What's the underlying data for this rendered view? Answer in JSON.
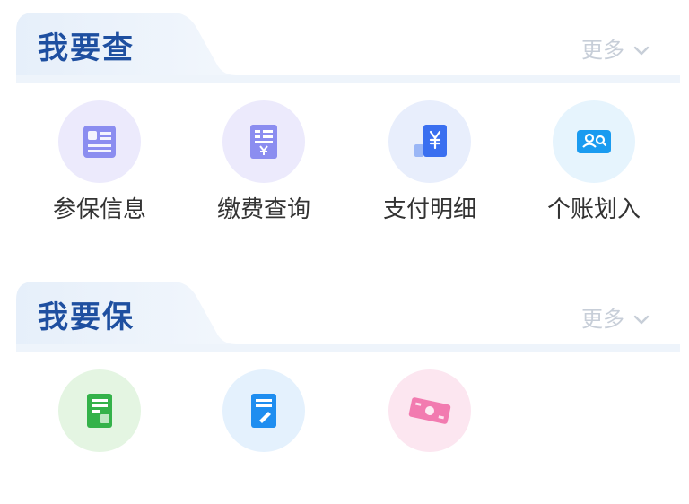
{
  "sections": [
    {
      "title": "我要查",
      "more_label": "更多",
      "items": [
        {
          "label": "参保信息",
          "icon": "id-card-icon",
          "color": "#8b8df0",
          "bg": "#eceafc"
        },
        {
          "label": "缴费查询",
          "icon": "payment-document-icon",
          "color": "#8b8df0",
          "bg": "#eceafc"
        },
        {
          "label": "支付明细",
          "icon": "yuan-bill-icon",
          "color": "#3a6ff0",
          "bg": "#e8eefc"
        },
        {
          "label": "个账划入",
          "icon": "account-search-icon",
          "color": "#1a9bf0",
          "bg": "#e6f4fd"
        }
      ]
    },
    {
      "title": "我要保",
      "more_label": "更多",
      "items": [
        {
          "label": "",
          "icon": "green-form-icon",
          "color": "#34b24a",
          "bg": "#e4f5e2"
        },
        {
          "label": "",
          "icon": "blue-edit-form-icon",
          "color": "#1f8ef0",
          "bg": "#e4f1fd"
        },
        {
          "label": "",
          "icon": "pink-ticket-icon",
          "color": "#f27bb0",
          "bg": "#fce6f0"
        }
      ]
    }
  ],
  "colors": {
    "title": "#1e4fa0",
    "more": "#c7ced8",
    "header_gradient_start": "#e8f1fb",
    "label": "#333333"
  }
}
